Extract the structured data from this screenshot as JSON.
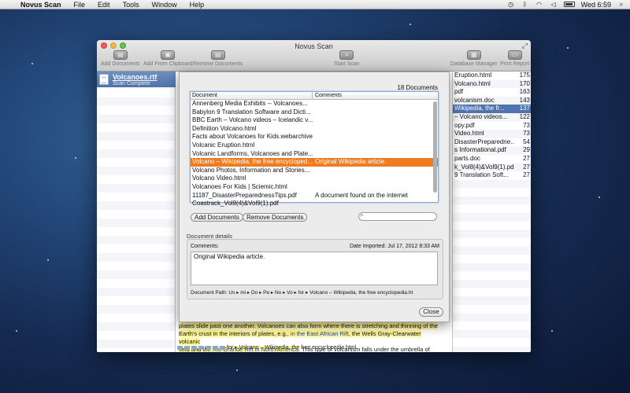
{
  "menubar": {
    "app_name": "Novus Scan",
    "items": [
      "File",
      "Edit",
      "Tools",
      "Window",
      "Help"
    ],
    "clock": "Wed 6:59"
  },
  "window": {
    "title": "Novus Scan",
    "toolbar": {
      "add_documents": "Add Documents",
      "add_from_clipboard": "Add From Clipboard",
      "remove_documents": "Remove Documents",
      "start_scan": "Start Scan",
      "database_manager": "Database Manager",
      "print_report": "Print Report"
    }
  },
  "sidebar": {
    "item_title": "Volcanoes.rtf",
    "item_status": "Scan Complete"
  },
  "stats": [
    {
      "name": "Eruption.html",
      "count": "175"
    },
    {
      "name": "Volcano.html",
      "count": "170"
    },
    {
      "name": "pdf",
      "count": "163"
    },
    {
      "name": "volcanism.doc",
      "count": "143"
    },
    {
      "name": "Wikipedia, the fr...",
      "count": "137"
    },
    {
      "name": "– Volcano videos...",
      "count": "122"
    },
    {
      "name": "opy.pdf",
      "count": "73"
    },
    {
      "name": "Video.html",
      "count": "73"
    },
    {
      "name": "DisasterPreparedne...",
      "count": "54"
    },
    {
      "name": "s Informational.pdf",
      "count": "29"
    },
    {
      "name": "parts.doc",
      "count": "27"
    },
    {
      "name": "k_Vol8(4)&Vol9(1).pdf",
      "count": "27"
    },
    {
      "name": "9 Translation Soft...",
      "count": "27"
    }
  ],
  "document": {
    "line1_a": "plates slide past one another. Volcanoes can also form where there is stretching and thinning of the",
    "line2_a": "Earth's crust in the interiors of plates, e.g., ",
    "line2_link1": "in the East African Rift",
    "line2_b": ", the Wells Gray-Clearwater volcanic",
    "line3_a": "field and the ",
    "line3_link2": "Rio Grande Rift in North America",
    "line3_b": ". This type of volcanism falls under the umbrella of",
    "path_text": "for ▸  Volcano – Wikipedia, the free encyclopedia.html"
  },
  "sheet": {
    "doc_count": "18 Documents",
    "col_document": "Document",
    "col_comments": "Comments",
    "rows": [
      {
        "document": "Annenberg Media Exhibits -- Volcanoes...",
        "comment": ""
      },
      {
        "document": "Babylon 9 Translation Software and Dicti...",
        "comment": ""
      },
      {
        "document": "BBC Earth – Volcano videos – Icelandic v...",
        "comment": ""
      },
      {
        "document": "Definition Volcano.html",
        "comment": ""
      },
      {
        "document": "Facts about Volcanoes for Kids.webarchive",
        "comment": ""
      },
      {
        "document": "Volcanic Eruption.html",
        "comment": ""
      },
      {
        "document": "Volcanic Landforms, Volcanoes and Plate...",
        "comment": ""
      },
      {
        "document": "Volcano – Wikipedia, the free encycloped...",
        "comment": "Original Wikipedia article.",
        "selected": true
      },
      {
        "document": "Volcano Photos, Information and Stories...",
        "comment": ""
      },
      {
        "document": "Volcano Video.html",
        "comment": ""
      },
      {
        "document": "Volcanoes For Kids | Sciemic.html",
        "comment": ""
      },
      {
        "document": "11187_DisasterPreparednessTips.pdf",
        "comment": "A document found on the internet"
      },
      {
        "document": "Coastrack_Vol8(4)&Vol9(1).pdf",
        "comment": ""
      }
    ],
    "add_documents": "Add Documents",
    "remove_documents": "Remove Documents",
    "search_placeholder": "",
    "details_label": "Document details",
    "comments_label": "Comments:",
    "date_imported": "Date Imported:  Jul 17, 2012 8:33 AM",
    "comments_value": "Original Wikipedia article.",
    "path_label": "Document Path:  Us ▸ mi ▸ Do ▸ Pe ▸ No ▸ Vo ▸ for ▸  Volcano – Wikipedia, the free encyclopedia.ht",
    "close": "Close"
  }
}
